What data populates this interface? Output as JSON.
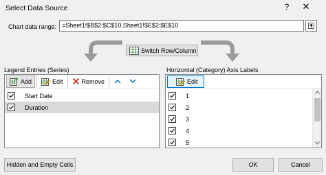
{
  "window": {
    "title": "Select Data Source",
    "help": "?",
    "close": "✕"
  },
  "range": {
    "label": "Chart data range:",
    "value": "=Sheet1!$B$2:$C$10,Sheet1!$E$2:$E$10"
  },
  "switch_label": "Switch Row/Column",
  "legend": {
    "heading": "Legend Entries (Series)",
    "add_label": "Add",
    "edit_label": "Edit",
    "remove_label": "Remove",
    "items": [
      {
        "label": "Start Date"
      },
      {
        "label": "Duration"
      }
    ]
  },
  "axis": {
    "heading": "Horizontal (Category) Axis Labels",
    "edit_label": "Edit",
    "items": [
      {
        "label": "1"
      },
      {
        "label": "2"
      },
      {
        "label": "3"
      },
      {
        "label": "4"
      },
      {
        "label": "5"
      }
    ]
  },
  "footer": {
    "hidden_label": "Hidden and Empty Cells",
    "ok_label": "OK",
    "cancel_label": "Cancel"
  },
  "colors": {
    "accent": "#0078d7",
    "remove_red": "#c42b1c",
    "grid_green": "#2e7d32",
    "arrow_gray": "#9a9a9a"
  },
  "icons": [
    "help-icon",
    "close-icon",
    "collapse-range-icon",
    "switch-icon",
    "add-icon",
    "edit-icon",
    "remove-icon",
    "move-up-icon",
    "move-down-icon",
    "checkbox-icon"
  ]
}
